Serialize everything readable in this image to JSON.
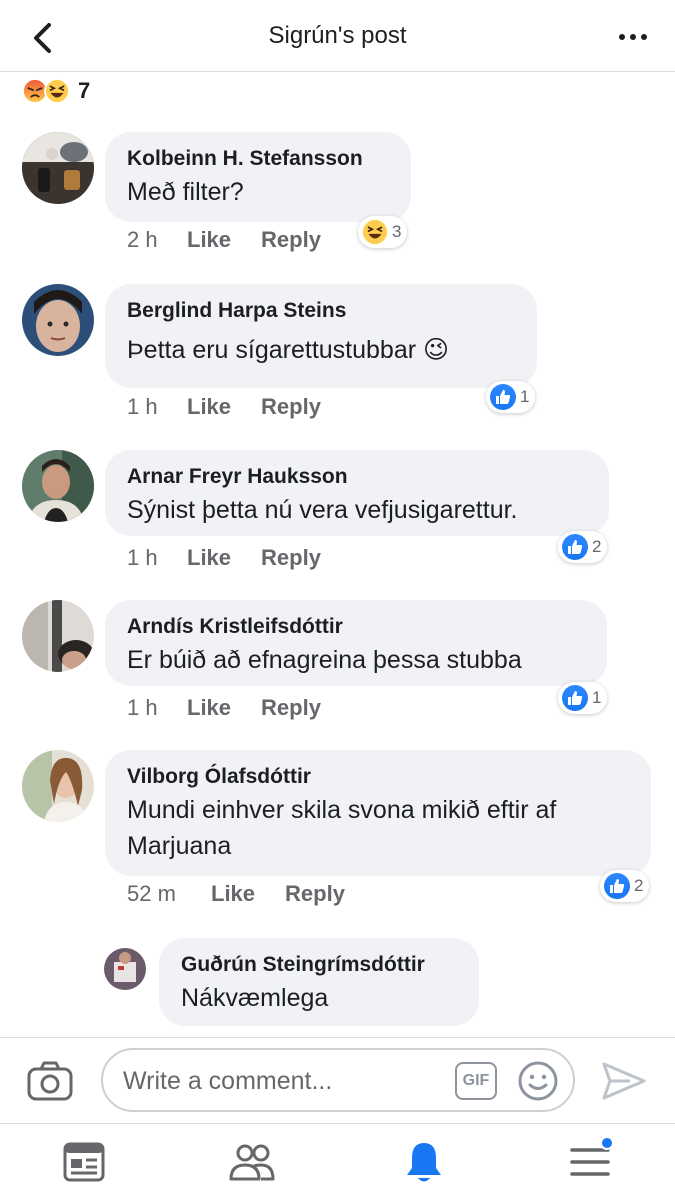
{
  "header": {
    "title": "Sigrún's post"
  },
  "post_reactions": {
    "count": "7",
    "types": [
      "angry",
      "haha"
    ]
  },
  "comments": [
    {
      "name": "Kolbeinn H. Stefansson",
      "text": "Með filter?",
      "time": "2 h",
      "like_label": "Like",
      "reply_label": "Reply",
      "reaction": {
        "type": "haha",
        "count": "3"
      }
    },
    {
      "name": "Berglind Harpa Steins",
      "text": "Þetta eru sígarettustubbar 😉",
      "time": "1 h",
      "like_label": "Like",
      "reply_label": "Reply",
      "reaction": {
        "type": "like",
        "count": "1"
      }
    },
    {
      "name": "Arnar Freyr Hauksson",
      "text": "Sýnist þetta nú vera vefjusigarettur.",
      "time": "1 h",
      "like_label": "Like",
      "reply_label": "Reply",
      "reaction": {
        "type": "like",
        "count": "2"
      }
    },
    {
      "name": "Arndís Kristleifsdóttir",
      "text": "Er búið að efnagreina þessa stubba",
      "time": "1 h",
      "like_label": "Like",
      "reply_label": "Reply",
      "reaction": {
        "type": "like",
        "count": "1"
      }
    },
    {
      "name": "Vilborg Ólafsdóttir",
      "text": "Mundi einhver skila svona mikið eftir af Marjuana",
      "time": "52 m",
      "like_label": "Like",
      "reply_label": "Reply",
      "reaction": {
        "type": "like",
        "count": "2"
      }
    }
  ],
  "reply": {
    "name": "Guðrún Steingrímsdóttir",
    "text": "Nákvæmlega"
  },
  "composer": {
    "placeholder": "Write a comment...",
    "gif_label": "GIF"
  },
  "bottom_nav": {
    "items": [
      "news-feed",
      "friends",
      "notifications",
      "menu"
    ],
    "active": "notifications",
    "menu_badge": true
  },
  "colors": {
    "accent": "#1877f2",
    "bubble": "#f0f2f5",
    "meta_text": "#65676b"
  }
}
